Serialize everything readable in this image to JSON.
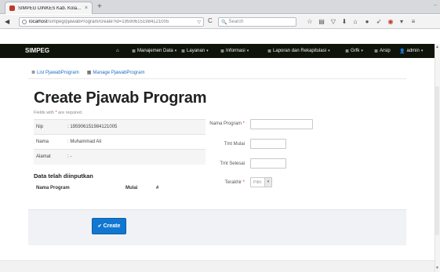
{
  "browser": {
    "tab_title": "SIMPEG DINKES Kab. Kola...",
    "tab_close": "×",
    "new_tab": "+",
    "window_min": "–",
    "back": "◀",
    "url_host": "localhost",
    "url_path": "/simpeg/pjawabProgram/create?id=195906151984121005",
    "url_dropdown": "▽",
    "reload": "C",
    "search_placeholder": "Search"
  },
  "app": {
    "brand": "SIMPEG",
    "menu": [
      {
        "label": "Manajemen Data",
        "has_caret": true
      },
      {
        "label": "Layanan",
        "has_caret": true
      },
      {
        "label": "Informasi",
        "has_caret": true
      },
      {
        "label": "Laporan dan Rekapitulasi",
        "has_caret": true
      },
      {
        "label": "Grfk",
        "has_caret": true
      },
      {
        "label": "Arsip",
        "has_caret": false
      },
      {
        "label": "admin",
        "has_caret": true
      }
    ]
  },
  "links": {
    "list": "List PjawabProgram",
    "manage": "Manage PjawabProgram"
  },
  "page": {
    "title": "Create Pjawab Program",
    "required_note_prefix": "Fields with ",
    "required_note_star": "*",
    "required_note_suffix": " are required."
  },
  "info": {
    "rows": [
      {
        "key": "Nip",
        "value": ": 195906151984121005"
      },
      {
        "key": "Nama",
        "value": ": Muhammad Ali"
      },
      {
        "key": "Alamat",
        "value": ": -"
      }
    ]
  },
  "entered": {
    "heading": "Data telah diinputkan",
    "columns": [
      "Nama Program",
      "Mulai",
      "#"
    ]
  },
  "form": {
    "nama_program_label": "Nama Program",
    "tmt_mulai_label": "Tmt Mulai",
    "tmt_selesai_label": "Tmt Selesai",
    "terakhir_label": "Terakhir",
    "terakhir_placeholder": "Pilih",
    "required_star": "*"
  },
  "actions": {
    "create_label": "Create"
  },
  "colors": {
    "header_bg": "#0f140b",
    "link": "#1f6fc5",
    "primary_button": "#1177d1",
    "required_star": "#dd3333"
  }
}
